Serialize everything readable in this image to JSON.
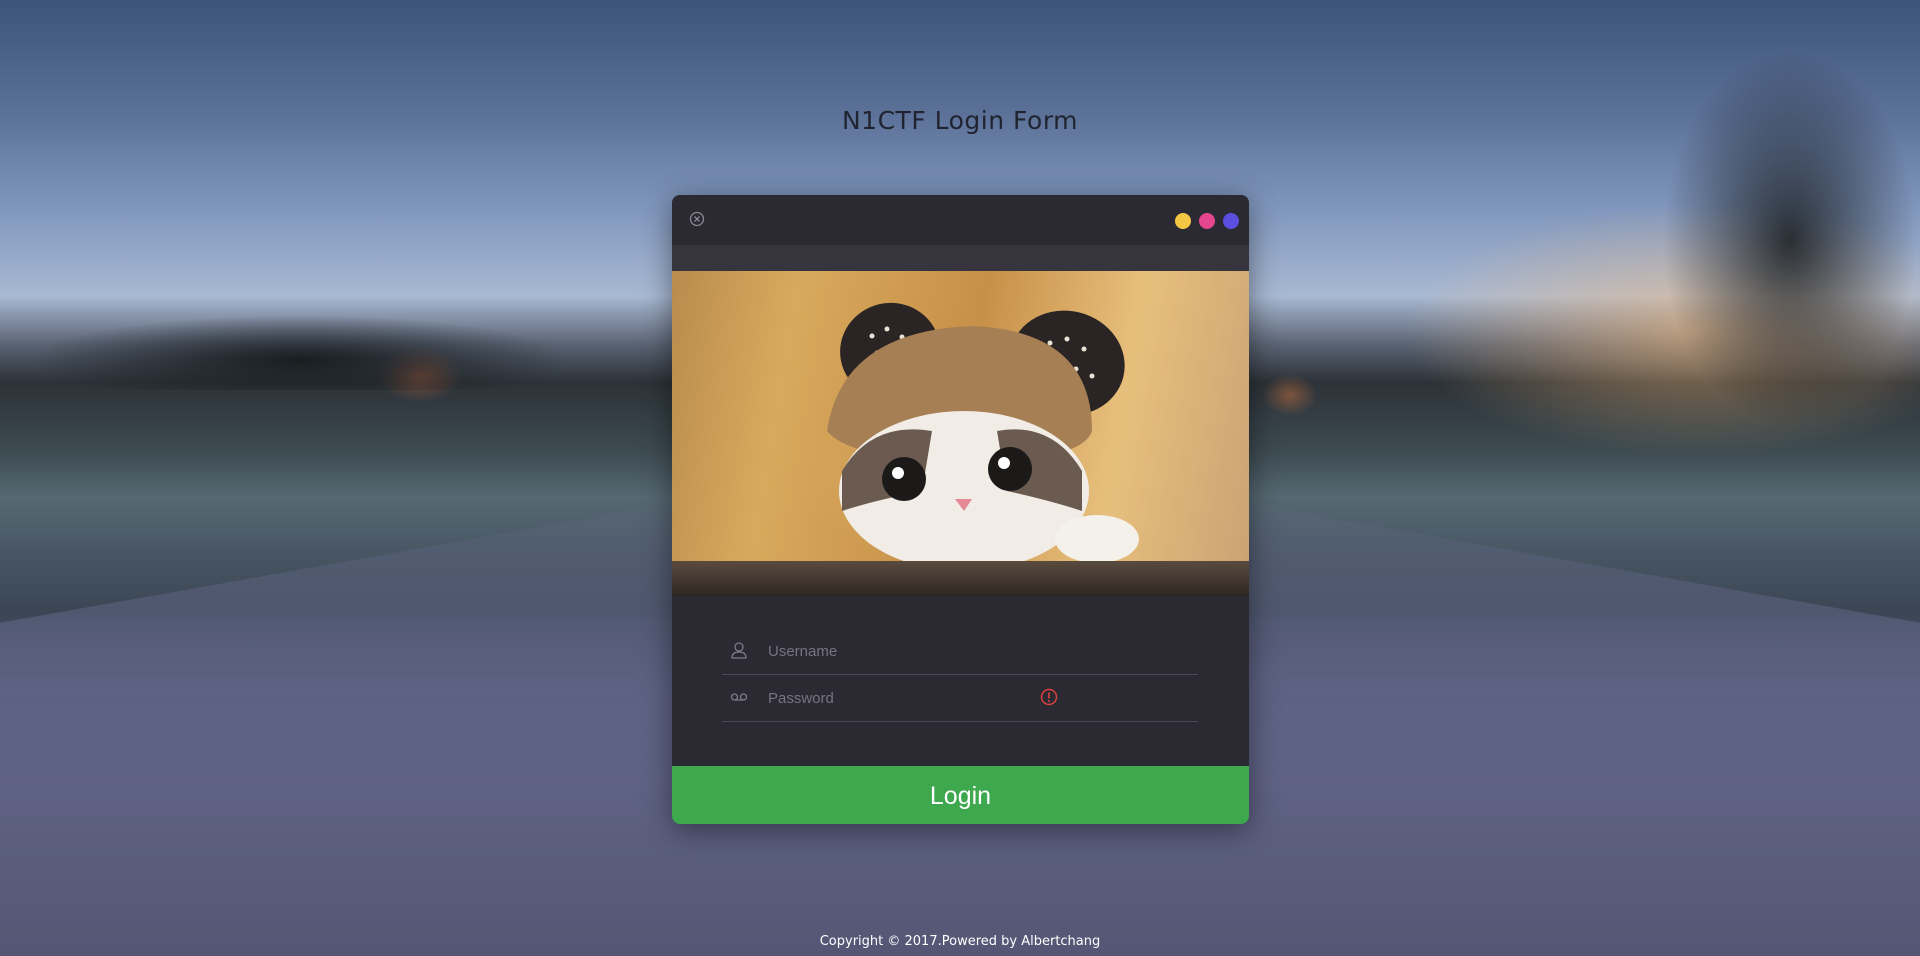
{
  "page": {
    "title": "N1CTF Login Form"
  },
  "window": {
    "dots": [
      {
        "name": "yellow-dot",
        "color": "#f3c744"
      },
      {
        "name": "pink-dot",
        "color": "#e6468f"
      },
      {
        "name": "purple-dot",
        "color": "#5a4fe0"
      }
    ]
  },
  "photo": {
    "subject": "kitten wearing a bear-ear hat"
  },
  "form": {
    "username": {
      "placeholder": "Username",
      "icon": "user-icon"
    },
    "password": {
      "placeholder": "Password",
      "icon": "voicemail-icon",
      "alert_icon": "exclamation-circle-icon"
    },
    "login_label": "Login",
    "login_color": "#3ea84f"
  },
  "footer": {
    "text": "Copyright © 2017.Powered by Albertchang"
  }
}
